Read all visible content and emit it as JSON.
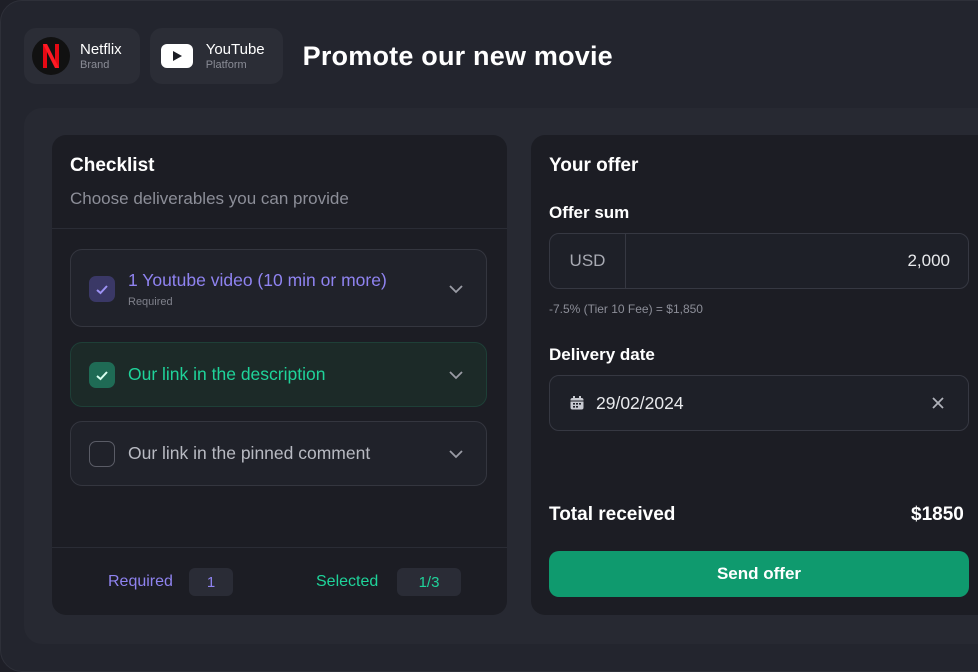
{
  "header": {
    "brand_chip": {
      "name": "Netflix",
      "role": "Brand",
      "icon": "netflix-logo"
    },
    "platform_chip": {
      "name": "YouTube",
      "role": "Platform",
      "icon": "youtube-logo"
    },
    "title": "Promote our new movie"
  },
  "checklist": {
    "title": "Checklist",
    "subtitle": "Choose deliverables you can provide",
    "items": [
      {
        "label": "1 Youtube video (10 min or more)",
        "note": "Required",
        "state": "required-checked",
        "color": "#8f83f0"
      },
      {
        "label": "Our link in the description",
        "note": "",
        "state": "checked",
        "color": "#1fd39a"
      },
      {
        "label": "Our link in the pinned comment",
        "note": "",
        "state": "unchecked",
        "color": "#b8bac2"
      }
    ],
    "footer": {
      "required_label": "Required",
      "required_count": "1",
      "selected_label": "Selected",
      "selected_count": "1/3"
    }
  },
  "offer": {
    "title": "Your offer",
    "sum_label": "Offer sum",
    "currency": "USD",
    "amount": "2,000",
    "fee_note": "-7.5% (Tier 10 Fee) = $1,850",
    "date_label": "Delivery date",
    "date_value": "29/02/2024",
    "total_label": "Total received",
    "total_value": "$1850",
    "send_label": "Send offer"
  },
  "colors": {
    "accent_green": "#0f9a6e",
    "required_purple": "#8f83f0",
    "selected_green": "#1fd39a"
  }
}
